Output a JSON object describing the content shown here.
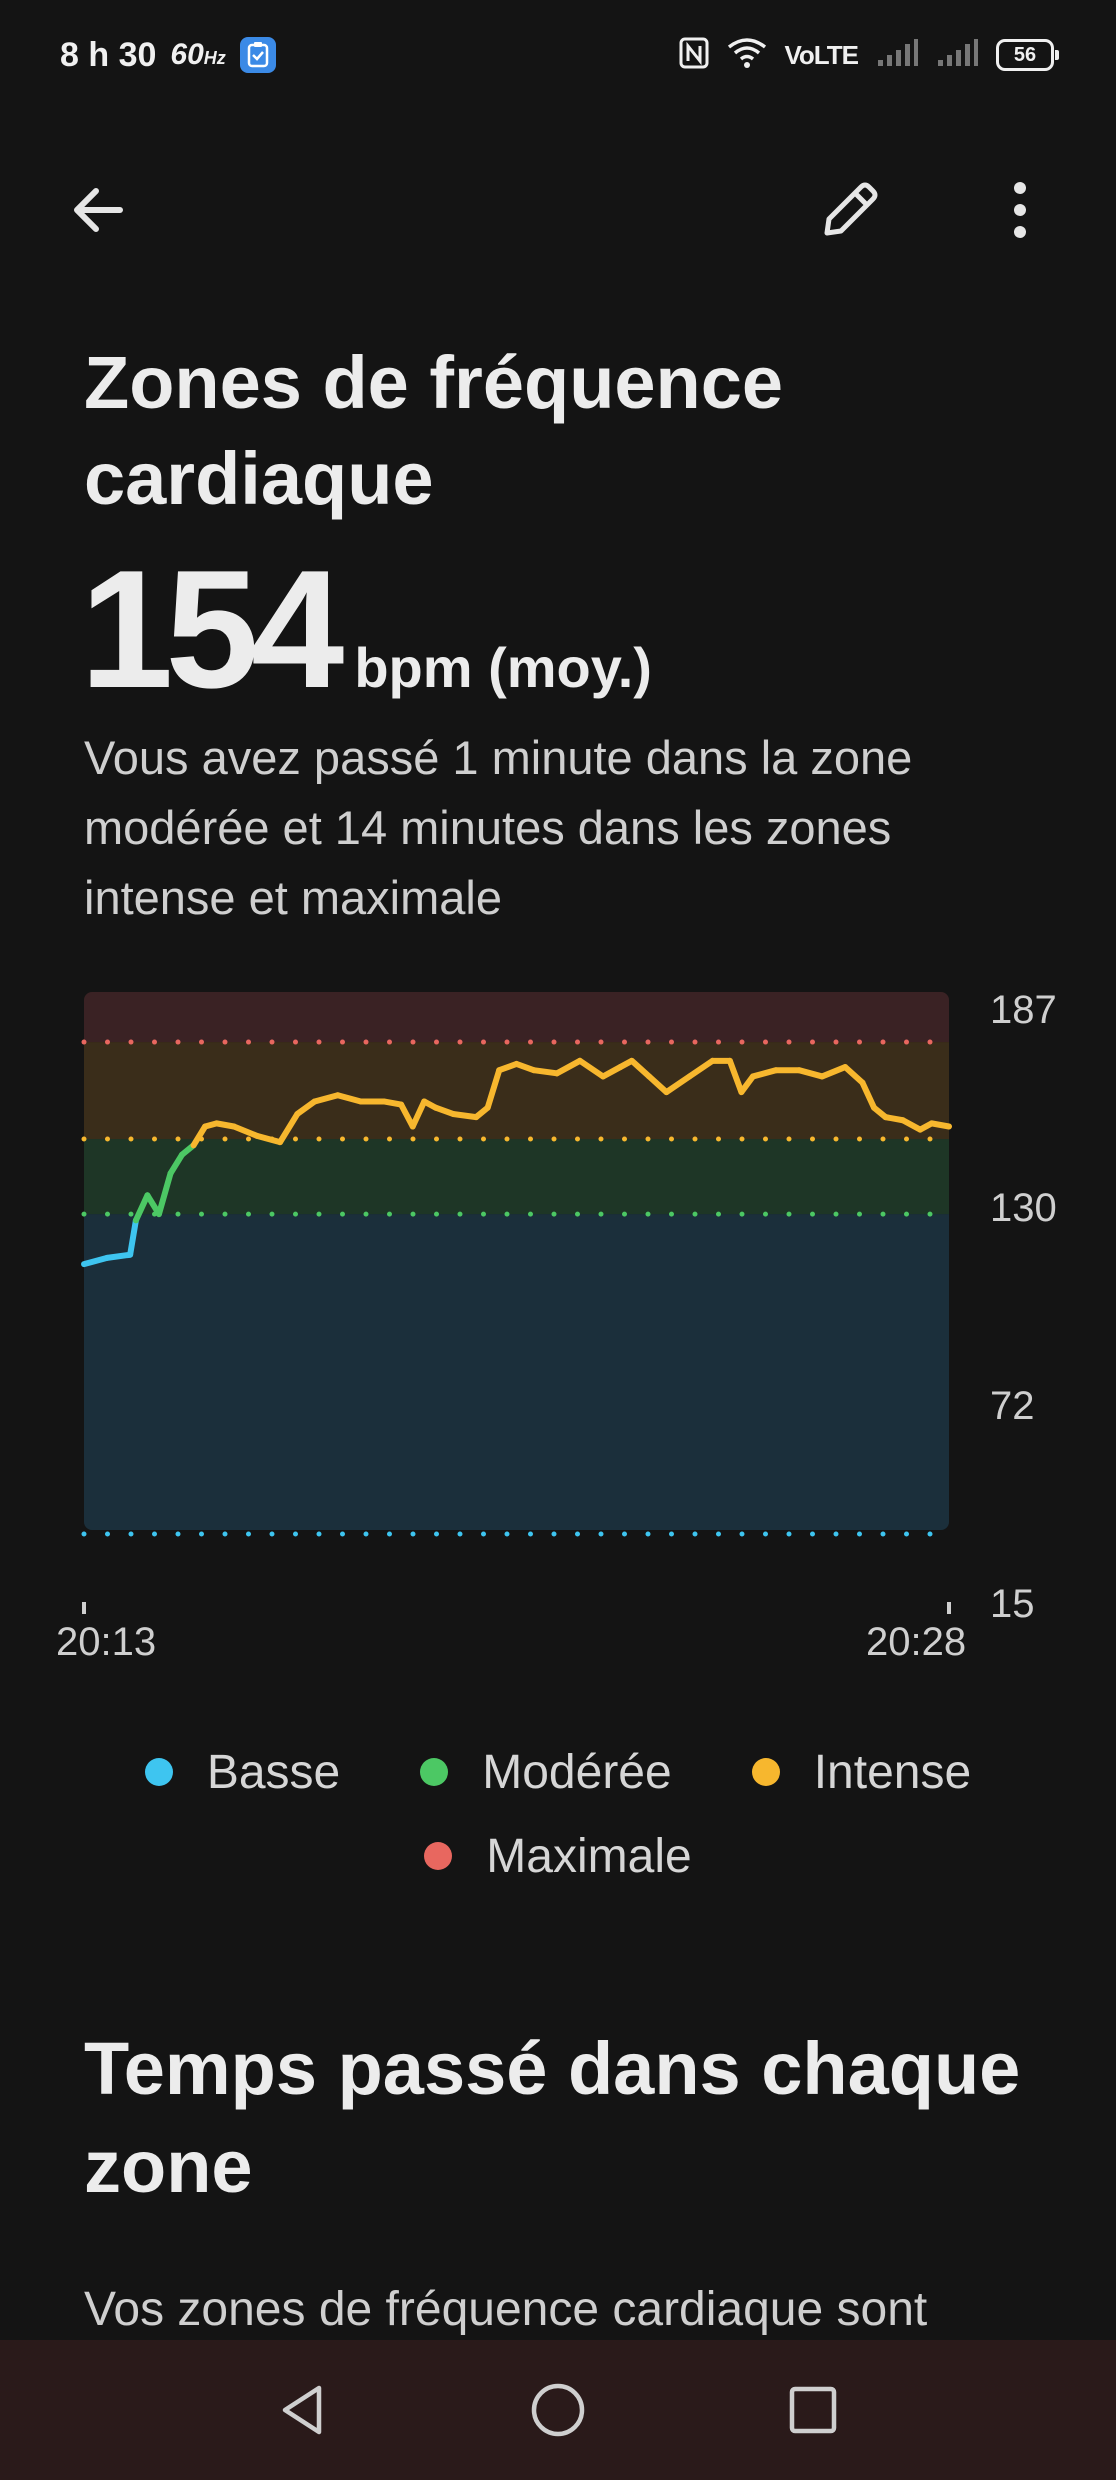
{
  "status_bar": {
    "time": "8 h 30",
    "refresh_rate": "60",
    "refresh_unit": "Hz",
    "network": "VoLTE",
    "battery": "56"
  },
  "header": {
    "title": "Zones de fréquence cardiaque",
    "back_icon": "arrow-left-icon",
    "edit_icon": "pencil-icon",
    "more_icon": "more-vertical-icon"
  },
  "summary": {
    "bpm_value": "154",
    "bpm_unit": "bpm (moy.)",
    "text": "Vous avez passé 1 minute dans la zone modérée et 14 minutes dans les zones intense et maximale"
  },
  "colors": {
    "basse": "#3ec5f0",
    "moderee": "#4cc864",
    "intense": "#f7b72e",
    "maximale": "#e8675f"
  },
  "chart_data": {
    "type": "line",
    "y_ticks": [
      "187",
      "130",
      "72",
      "15"
    ],
    "ylim": [
      15,
      187
    ],
    "x_ticks": [
      "20:13",
      "20:28"
    ],
    "zones": [
      {
        "name": "Basse",
        "from": 15,
        "to": 116,
        "color": "#3ec5f0"
      },
      {
        "name": "Modérée",
        "from": 116,
        "to": 140,
        "color": "#4cc864"
      },
      {
        "name": "Intense",
        "from": 140,
        "to": 171,
        "color": "#f7b72e"
      },
      {
        "name": "Maximale",
        "from": 171,
        "to": 187,
        "color": "#e8675f"
      }
    ],
    "series": [
      {
        "x_minutes": [
          0,
          0.4,
          0.8,
          0.9,
          1.1,
          1.3,
          1.5,
          1.7,
          1.9,
          2.1,
          2.3,
          2.6,
          3.0,
          3.4,
          3.7,
          4.0,
          4.4,
          4.8,
          5.2,
          5.5,
          5.7,
          5.9,
          6.1,
          6.4,
          6.8,
          7.0,
          7.2,
          7.5,
          7.8,
          8.2,
          8.6,
          9.0,
          9.3,
          9.5,
          9.8,
          10.1,
          10.5,
          10.9,
          11.2,
          11.4,
          11.6,
          12.0,
          12.4,
          12.8,
          13.2,
          13.5,
          13.7,
          13.9,
          14.2,
          14.5,
          14.7,
          15.0
        ],
        "bpm": [
          100,
          102,
          103,
          114,
          122,
          116,
          129,
          135,
          138,
          144,
          145,
          144,
          141,
          139,
          148,
          152,
          154,
          152,
          152,
          151,
          144,
          152,
          150,
          148,
          147,
          150,
          162,
          164,
          162,
          161,
          165,
          160,
          163,
          165,
          160,
          155,
          160,
          165,
          165,
          155,
          160,
          162,
          162,
          160,
          163,
          158,
          150,
          147,
          146,
          143,
          145,
          144
        ]
      }
    ]
  },
  "legend": [
    {
      "label": "Basse",
      "color": "#3ec5f0"
    },
    {
      "label": "Modérée",
      "color": "#4cc864"
    },
    {
      "label": "Intense",
      "color": "#f7b72e"
    },
    {
      "label": "Maximale",
      "color": "#e8675f"
    }
  ],
  "section": {
    "title": "Temps passé dans chaque zone",
    "text": "Vos zones de fréquence cardiaque sont"
  },
  "nav": {
    "back_icon": "nav-back-icon",
    "home_icon": "nav-home-icon",
    "recents_icon": "nav-recents-icon"
  }
}
